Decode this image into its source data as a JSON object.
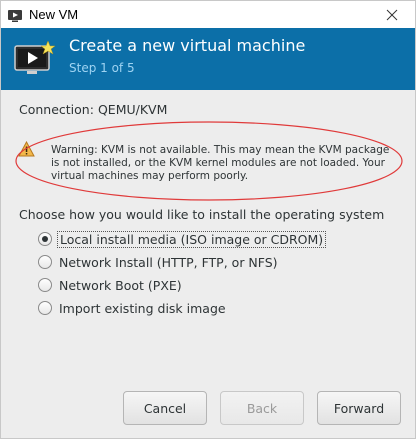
{
  "window": {
    "title": "New VM"
  },
  "header": {
    "title": "Create a new virtual machine",
    "step": "Step 1 of 5"
  },
  "connection": {
    "label": "Connection:",
    "value": "QEMU/KVM"
  },
  "warning": {
    "text": "Warning: KVM is not available. This may mean the KVM package is not installed, or the KVM kernel modules are not loaded. Your virtual machines may perform poorly."
  },
  "install": {
    "prompt": "Choose how you would like to install the operating system",
    "options": [
      {
        "label": "Local install media (ISO image or CDROM)",
        "selected": true
      },
      {
        "label": "Network Install (HTTP, FTP, or NFS)",
        "selected": false
      },
      {
        "label": "Network Boot (PXE)",
        "selected": false
      },
      {
        "label": "Import existing disk image",
        "selected": false
      }
    ]
  },
  "buttons": {
    "cancel": "Cancel",
    "back": "Back",
    "forward": "Forward"
  },
  "colors": {
    "banner": "#0c6fa8",
    "step_text": "#9ed3f2",
    "annotation": "#e03a3a",
    "warning_icon": "#e8a33c"
  }
}
